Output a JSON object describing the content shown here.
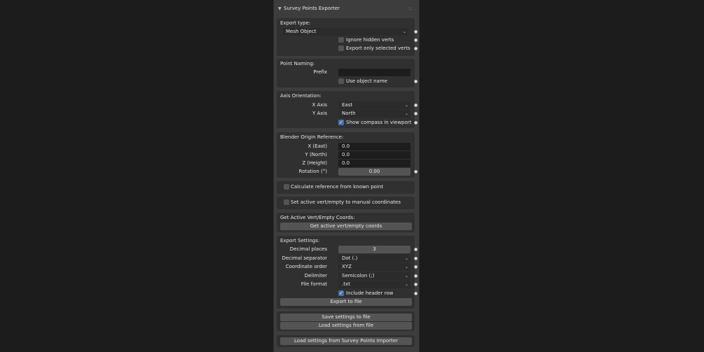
{
  "panel": {
    "title": "Survey Points Exporter"
  },
  "export_type": {
    "heading": "Export type:",
    "value": "Mesh Object",
    "ignore_hidden_label": "Ignore hidden verts",
    "ignore_hidden": false,
    "selected_only_label": "Export only selected verts",
    "selected_only": false
  },
  "naming": {
    "heading": "Point Naming:",
    "prefix_label": "Prefix",
    "prefix_value": "",
    "use_object_name_label": "Use object name",
    "use_object_name": false
  },
  "axis": {
    "heading": "Axis Orientation:",
    "x_label": "X Axis",
    "x_value": "East",
    "y_label": "Y Axis",
    "y_value": "North",
    "compass_label": "Show compass in viewport",
    "compass": true
  },
  "origin": {
    "heading": "Blender Origin Reference:",
    "x_label": "X (East)",
    "x_value": "0.0",
    "y_label": "Y (North)",
    "y_value": "0.0",
    "z_label": "Z (Height)",
    "z_value": "0.0",
    "rot_label": "Rotation (°)",
    "rot_value": "0.00"
  },
  "calc_ref": {
    "label": "Calculate reference from known point",
    "checked": false
  },
  "set_active": {
    "label": "Set active vert/empty to manual coordinates",
    "checked": false
  },
  "get_coords": {
    "heading": "Get Active Vert/Empty Coords:",
    "button": "Get active vert/empty coords"
  },
  "export_settings": {
    "heading": "Export Settings:",
    "decimal_label": "Decimal places",
    "decimal_value": "3",
    "separator_label": "Decimal separator",
    "separator_value": "Dot (.)",
    "order_label": "Coordinate order",
    "order_value": "XYZ",
    "delimiter_label": "Delimiter",
    "delimiter_value": "Semicolon (;)",
    "format_label": "File format",
    "format_value": ".txt",
    "header_label": "Include header row",
    "header": true,
    "export_button": "Export to file"
  },
  "settings_file": {
    "save_button": "Save settings to file",
    "load_button": "Load settings from file"
  },
  "importer": {
    "button": "Load settings from Survey Points Importer"
  },
  "icons": {
    "chevron": "chevron-down-icon",
    "dot": "animate-dot-icon",
    "grip": "drag-grip-icon"
  }
}
